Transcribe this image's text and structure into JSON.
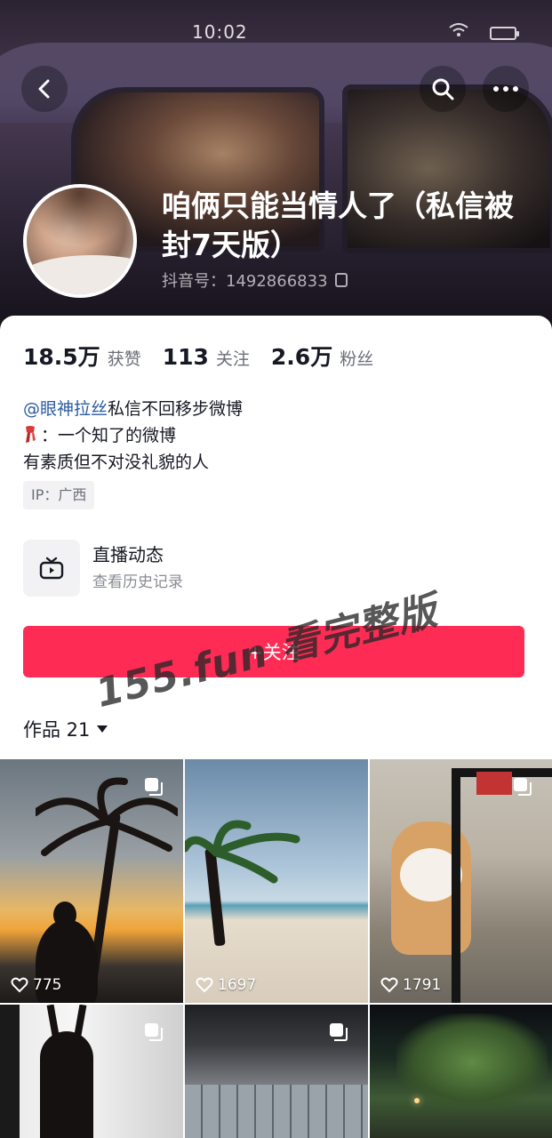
{
  "status_bar": {
    "time": "10:02"
  },
  "header": {
    "nickname": "咱俩只能当情人了（私信被封7天版）",
    "douyin_id": "抖音号：1492866833"
  },
  "stats": [
    {
      "value": "18.5万",
      "label": "获赞"
    },
    {
      "value": "113",
      "label": "关注"
    },
    {
      "value": "2.6万",
      "label": "粉丝"
    }
  ],
  "bio": {
    "mention": "@眼神拉丝",
    "line1_rest": "私信不回移步微博",
    "line2": "：一个知了的微博",
    "line3": "有素质但不对没礼貌的人"
  },
  "ip_tag": "IP：广西",
  "live": {
    "title": "直播动态",
    "subtitle": "查看历史记录"
  },
  "follow_button": "+关注",
  "watermark": "155.fun 看完整版",
  "works_tab": "作品 21",
  "posts": [
    {
      "likes": "775",
      "multi": true
    },
    {
      "likes": "1697",
      "multi": false
    },
    {
      "likes": "1791",
      "multi": true
    },
    {
      "likes": "",
      "multi": true
    },
    {
      "likes": "",
      "multi": true
    },
    {
      "likes": "",
      "multi": false
    }
  ],
  "colors": {
    "accent": "#fe2c55",
    "mention": "#2a5b9f"
  },
  "icons": [
    "back-icon",
    "search-icon",
    "more-icon",
    "copy-icon",
    "scarf-icon",
    "live-tv-icon",
    "heart-icon",
    "multi-image-icon"
  ]
}
